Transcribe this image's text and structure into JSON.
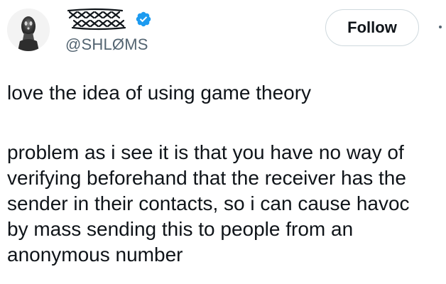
{
  "tweet": {
    "author": {
      "display_name": "XXXXX",
      "handle": "@SHLØMS",
      "verified_icon": "verified-badge",
      "brand_color": "#1d9bf0"
    },
    "follow_label": "Follow",
    "body": {
      "paragraph_1": [
        "love the idea of using game theory"
      ],
      "paragraph_2": [
        "problem as i see it is that you have no way of",
        "verifying beforehand that the receiver has the",
        "sender in their contacts, so i can cause havoc",
        "by mass sending this to people from an",
        "anonymous number"
      ]
    },
    "colors": {
      "text": "#0f1419",
      "secondary_text": "#536471",
      "follow_border": "#cfd9de"
    }
  }
}
